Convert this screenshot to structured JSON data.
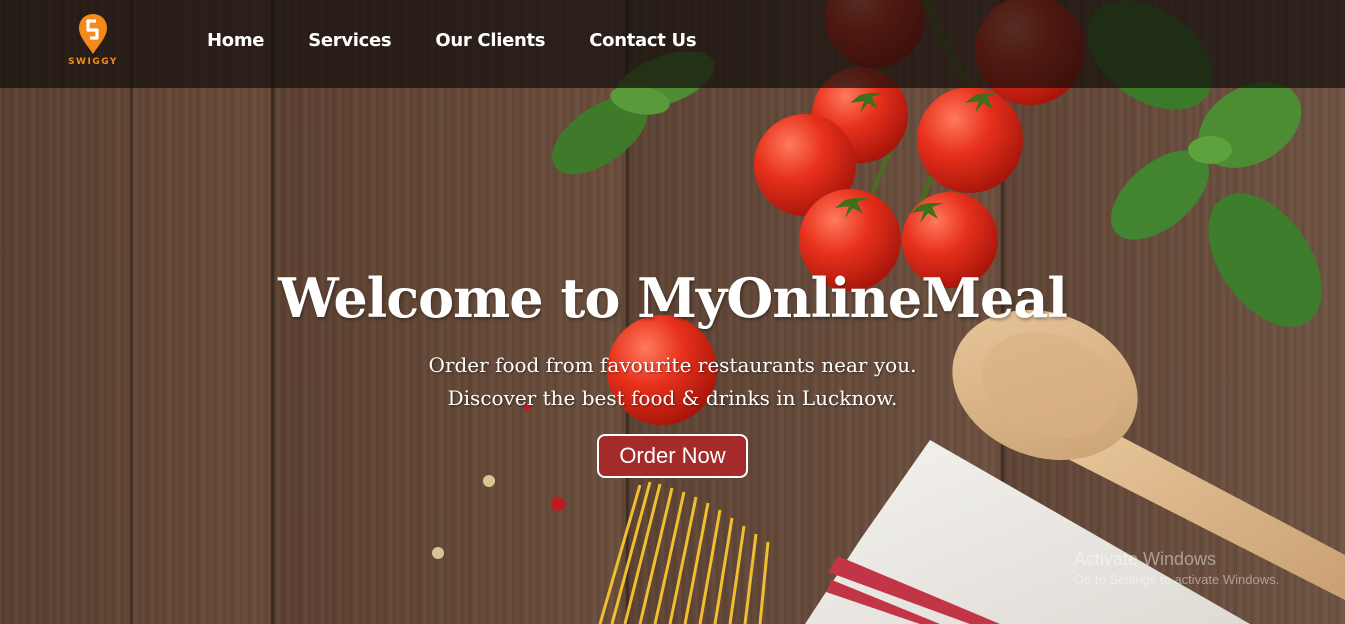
{
  "brand": {
    "logo_text": "SWIGGY",
    "color": "#f48a1c"
  },
  "nav": {
    "items": [
      {
        "label": "Home"
      },
      {
        "label": "Services"
      },
      {
        "label": "Our Clients"
      },
      {
        "label": "Contact Us"
      }
    ]
  },
  "hero": {
    "title": "Welcome to MyOnlineMeal",
    "line1": "Order food from favourite restaurants near you.",
    "line2": "Discover the best food & drinks in Lucknow.",
    "button_label": "Order Now",
    "button_color": "#a52a2a"
  },
  "watermark": {
    "title": "Activate Windows",
    "subtitle": "Go to Settings to activate Windows."
  }
}
